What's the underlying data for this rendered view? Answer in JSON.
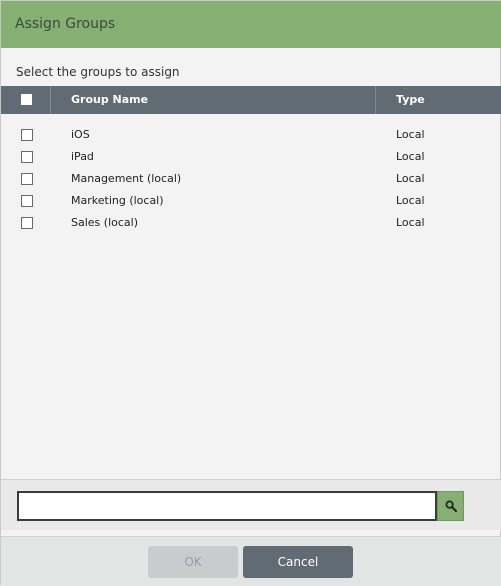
{
  "dialog": {
    "title": "Assign Groups",
    "instruction": "Select the groups to assign"
  },
  "table": {
    "columns": [
      "Group Name",
      "Type"
    ],
    "rows": [
      {
        "name": "iOS",
        "type": "Local",
        "checked": false
      },
      {
        "name": "iPad",
        "type": "Local",
        "checked": false
      },
      {
        "name": "Management (local)",
        "type": "Local",
        "checked": false
      },
      {
        "name": "Marketing (local)",
        "type": "Local",
        "checked": false
      },
      {
        "name": "Sales (local)",
        "type": "Local",
        "checked": false
      }
    ]
  },
  "search": {
    "value": "",
    "placeholder": "",
    "icon": "search-icon"
  },
  "footer": {
    "ok_label": "OK",
    "cancel_label": "Cancel"
  },
  "colors": {
    "title_bar": "#86b073",
    "header_bg": "#616b73",
    "cancel_bg": "#616b73",
    "ok_disabled_bg": "#c9cbcd"
  }
}
